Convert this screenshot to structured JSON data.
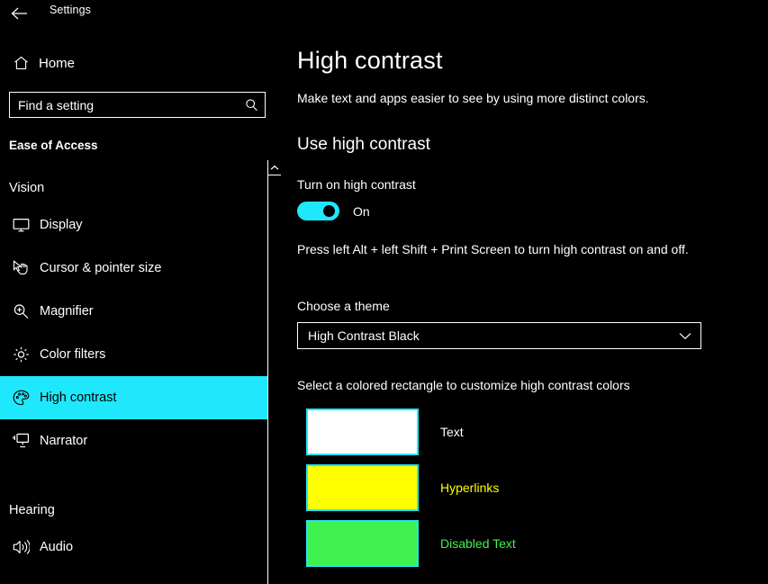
{
  "titlebar": {
    "back_icon": "back-arrow-icon",
    "app_title": "Settings"
  },
  "sidebar": {
    "home": {
      "icon": "home-icon",
      "label": "Home"
    },
    "search": {
      "icon": "search-icon",
      "placeholder": "Find a setting",
      "value": ""
    },
    "category": "Ease of Access",
    "groups": [
      {
        "title": "Vision",
        "items": [
          {
            "icon": "monitor-icon",
            "label": "Display",
            "selected": false
          },
          {
            "icon": "cursor-icon",
            "label": "Cursor & pointer size",
            "selected": false
          },
          {
            "icon": "magnifier-icon",
            "label": "Magnifier",
            "selected": false
          },
          {
            "icon": "brightness-icon",
            "label": "Color filters",
            "selected": false
          },
          {
            "icon": "palette-icon",
            "label": "High contrast",
            "selected": true
          },
          {
            "icon": "narrator-icon",
            "label": "Narrator",
            "selected": false
          }
        ]
      },
      {
        "title": "Hearing",
        "items": [
          {
            "icon": "speaker-icon",
            "label": "Audio",
            "selected": false
          }
        ]
      }
    ],
    "scrollbar": {
      "up_icon": "chevron-up-icon"
    }
  },
  "main": {
    "title": "High contrast",
    "subtitle": "Make text and apps easier to see by using more distinct colors.",
    "section_heading": "Use high contrast",
    "toggle": {
      "label": "Turn on high contrast",
      "state": "On",
      "checked": true
    },
    "hotkey_text": "Press left Alt + left Shift + Print Screen to turn high contrast on and off.",
    "theme": {
      "label": "Choose a theme",
      "selected": "High Contrast Black",
      "chevron_icon": "chevron-down-icon",
      "options": [
        "High Contrast Black"
      ]
    },
    "swatch_instruction": "Select a colored rectangle to customize high contrast colors",
    "swatches": [
      {
        "label": "Text",
        "color": "#FFFFFF",
        "label_color": "#FFFFFF"
      },
      {
        "label": "Hyperlinks",
        "color": "#FFFF00",
        "label_color": "#FFFF00"
      },
      {
        "label": "Disabled Text",
        "color": "#3FF24F",
        "label_color": "#3FF24F"
      }
    ]
  },
  "colors": {
    "accent_cyan": "#1FE8FC",
    "background": "#000000",
    "foreground": "#FFFFFF"
  }
}
